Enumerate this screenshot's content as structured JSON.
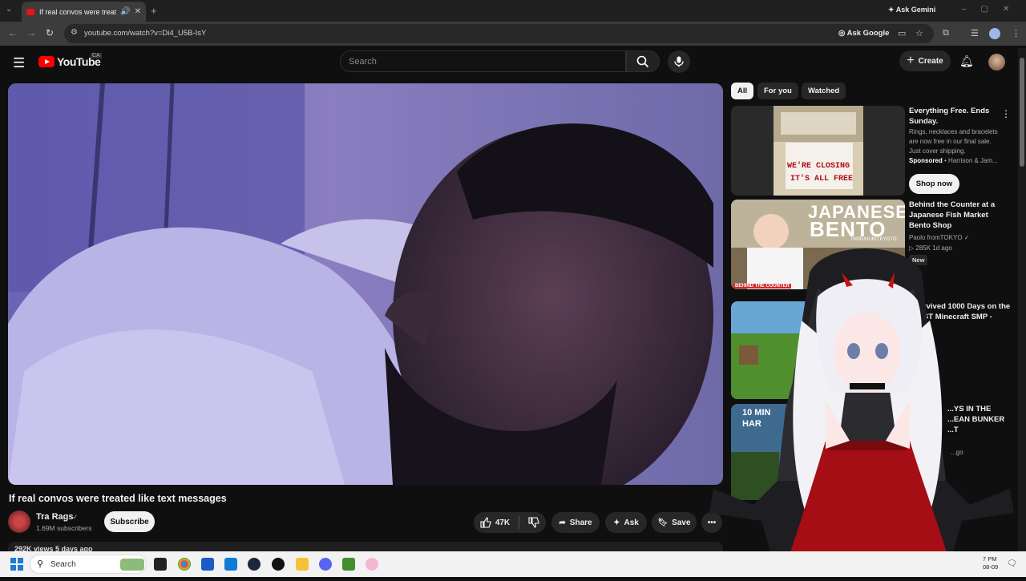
{
  "browser": {
    "tab_title": "If real convos were treated like text messages - YouTube",
    "ask_gemini": "Ask Gemini",
    "url": "youtube.com/watch?v=Di4_U5B-IsY",
    "ask_google": "Ask Google",
    "new_tab_glyph": "+",
    "tab_glyph_audio": "🔊",
    "tab_glyph_close": "✕"
  },
  "youtube": {
    "logo_text": "YouTube",
    "country_badge": "CA",
    "search_placeholder": "Search",
    "create_label": "Create"
  },
  "video": {
    "title": "If real convos were treated like text messages",
    "channel": "Tra Rags",
    "subscribers": "1.69M subscribers",
    "subscribe_label": "Subscribe",
    "likes": "47K",
    "share_label": "Share",
    "ask_label": "Ask",
    "save_label": "Save",
    "views_line": "292K views  5 days ago"
  },
  "sidebar": {
    "chips": [
      "All",
      "For you",
      "Watched"
    ],
    "ad": {
      "title": "Everything Free. Ends Sunday.",
      "desc": "Rings, necklaces and bracelets are now free in our final sale. Just cover shipping.",
      "sponsored": "Sponsored",
      "advertiser": "Harrison & Jam...",
      "thumb_text_1": "WE'RE CLOSING",
      "thumb_text_2": "IT'S ALL FREE",
      "cta": "Shop now"
    },
    "recs": [
      {
        "title": "Behind the Counter at a Japanese Fish Market Bento Shop",
        "channel": "Paolo fromTOKYO",
        "stats": "285K  1d ago",
        "badge": "New",
        "thumb_big": "JAPANESE",
        "thumb_big2": "BENTO",
        "thumb_small": "HARUHUKU KYOTO",
        "thumb_tag": "BEHIND THE COUNTER"
      },
      {
        "title": "...rvived 1000 Days on the ...ST Minecraft SMP -"
      },
      {
        "title": "...YS IN THE ...EAN BUNKER ...T",
        "meta": "...go",
        "thumb_text": "10 MIN HAR"
      }
    ]
  },
  "taskbar": {
    "search_label": "Search",
    "time": "7 PM",
    "date": "08-09"
  },
  "colors": {
    "yt_red": "#ff0000",
    "page_bg": "#0f0f0f",
    "taskbar_bg": "#f2f2f2"
  }
}
